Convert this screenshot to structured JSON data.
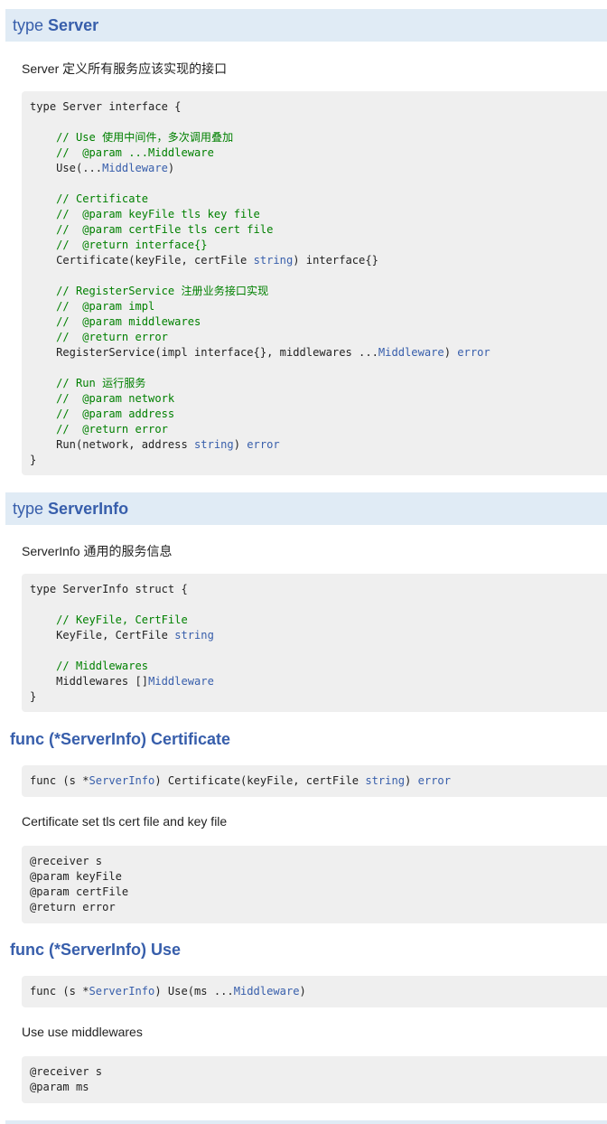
{
  "sections": {
    "server": {
      "keyword": "type",
      "name": "Server",
      "desc": "Server 定义所有服务应该实现的接口",
      "code": [
        {
          "t": "type Server interface {",
          "k": "plain"
        },
        {
          "t": "",
          "k": "plain"
        },
        {
          "t": "    // Use 使用中间件，多次调用叠加",
          "k": "comment"
        },
        {
          "t": "    //  @param ...Middleware",
          "k": "comment"
        },
        {
          "t": "    Use(...",
          "k": "plain",
          "typ": "Middleware",
          "tail": ")"
        },
        {
          "t": "",
          "k": "plain"
        },
        {
          "t": "    // Certificate",
          "k": "comment"
        },
        {
          "t": "    //  @param keyFile tls key file",
          "k": "comment"
        },
        {
          "t": "    //  @param certFile tls cert file",
          "k": "comment"
        },
        {
          "t": "    //  @return interface{}",
          "k": "comment"
        },
        {
          "t": "    Certificate(keyFile, certFile ",
          "k": "plain",
          "typ": "string",
          "tail": ") interface{}"
        },
        {
          "t": "",
          "k": "plain"
        },
        {
          "t": "    // RegisterService 注册业务接口实现",
          "k": "comment"
        },
        {
          "t": "    //  @param impl",
          "k": "comment"
        },
        {
          "t": "    //  @param middlewares",
          "k": "comment"
        },
        {
          "t": "    //  @return error",
          "k": "comment"
        },
        {
          "t": "    RegisterService(impl interface{}, middlewares ...",
          "k": "plain",
          "typ": "Middleware",
          "tail": ") ",
          "typ2": "error"
        },
        {
          "t": "",
          "k": "plain"
        },
        {
          "t": "    // Run 运行服务",
          "k": "comment"
        },
        {
          "t": "    //  @param network",
          "k": "comment"
        },
        {
          "t": "    //  @param address",
          "k": "comment"
        },
        {
          "t": "    //  @return error",
          "k": "comment"
        },
        {
          "t": "    Run(network, address ",
          "k": "plain",
          "typ": "string",
          "tail": ") ",
          "typ2": "error"
        },
        {
          "t": "}",
          "k": "plain"
        }
      ]
    },
    "serverinfo": {
      "keyword": "type",
      "name": "ServerInfo",
      "desc": "ServerInfo 通用的服务信息",
      "code": [
        {
          "t": "type ServerInfo struct {",
          "k": "plain"
        },
        {
          "t": "",
          "k": "plain"
        },
        {
          "t": "    // KeyFile, CertFile",
          "k": "comment"
        },
        {
          "t": "    KeyFile, CertFile ",
          "k": "plain",
          "typ": "string"
        },
        {
          "t": "",
          "k": "plain"
        },
        {
          "t": "    // Middlewares",
          "k": "comment"
        },
        {
          "t": "    Middlewares []",
          "k": "plain",
          "typ": "Middleware"
        },
        {
          "t": "}",
          "k": "plain"
        }
      ]
    },
    "certificate_func": {
      "title": "func (*ServerInfo) Certificate",
      "sig": [
        {
          "t": "func (s *",
          "k": "plain",
          "typ": "ServerInfo",
          "tail": ") Certificate(keyFile, certFile ",
          "typ2": "string",
          "tail2": ") ",
          "typ3": "error"
        }
      ],
      "desc": "Certificate set tls cert file and key file",
      "notes": [
        {
          "t": "@receiver s",
          "k": "plain"
        },
        {
          "t": "@param keyFile",
          "k": "plain"
        },
        {
          "t": "@param certFile",
          "k": "plain"
        },
        {
          "t": "@return error",
          "k": "plain"
        }
      ]
    },
    "use_func": {
      "title": "func (*ServerInfo) Use",
      "sig": [
        {
          "t": "func (s *",
          "k": "plain",
          "typ": "ServerInfo",
          "tail": ") Use(ms ...",
          "typ2": "Middleware",
          "tail2": ")"
        }
      ],
      "desc": "Use use middlewares",
      "notes": [
        {
          "t": "@receiver s",
          "k": "plain"
        },
        {
          "t": "@param ms",
          "k": "plain"
        }
      ]
    }
  },
  "colors": {
    "header_bg": "#e0ebf5",
    "link_blue": "#375eab",
    "comment_green": "#008000",
    "code_bg": "#efefef"
  }
}
